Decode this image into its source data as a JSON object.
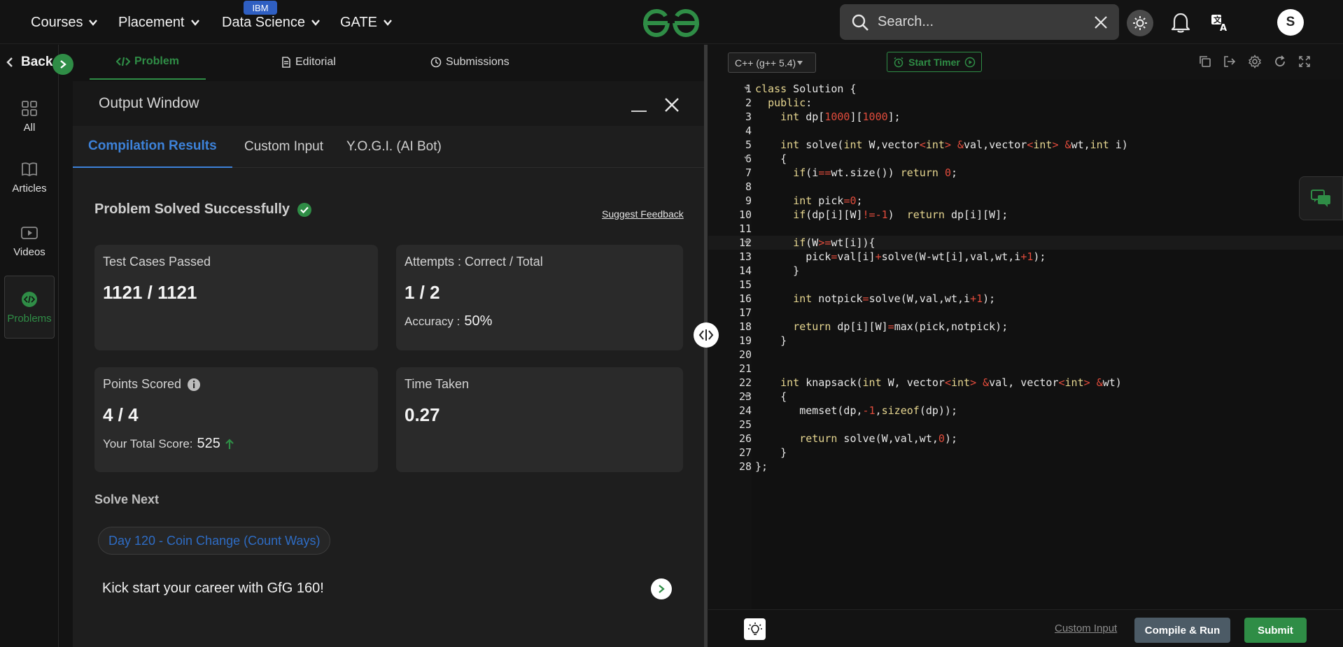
{
  "nav": {
    "items": [
      "Courses",
      "Placement",
      "Data Science",
      "GATE"
    ],
    "badge": "IBM",
    "search_placeholder": "Search...",
    "avatar_initial": "S"
  },
  "sidebar": {
    "back_label": "Back",
    "items": [
      {
        "label": "All",
        "icon": "grid-icon"
      },
      {
        "label": "Articles",
        "icon": "book-icon"
      },
      {
        "label": "Videos",
        "icon": "video-icon"
      },
      {
        "label": "Problems",
        "icon": "code-icon",
        "active": true
      }
    ]
  },
  "problem_tabs": [
    {
      "label": "Problem",
      "icon": "code-icon",
      "active": true
    },
    {
      "label": "Editorial",
      "icon": "document-icon"
    },
    {
      "label": "Submissions",
      "icon": "clock-icon"
    }
  ],
  "output": {
    "title": "Output Window",
    "tabs": [
      "Compilation Results",
      "Custom Input",
      "Y.O.G.I. (AI Bot)"
    ],
    "status": "Problem Solved Successfully",
    "suggest_feedback": "Suggest Feedback",
    "cards": {
      "tests": {
        "label": "Test Cases Passed",
        "value": "1121 / 1121"
      },
      "attempts": {
        "label": "Attempts : Correct / Total",
        "value": "1 / 2",
        "sub_label": "Accuracy :",
        "sub_value": "50%"
      },
      "points": {
        "label": "Points Scored",
        "value": "4 / 4",
        "sub_label": "Your Total Score:",
        "sub_value": "525"
      },
      "time": {
        "label": "Time Taken",
        "value": "0.27"
      }
    },
    "solve_next_label": "Solve Next",
    "next_problem": "Day 120 - Coin Change (Count Ways)",
    "kickstart": "Kick start your career with GfG 160!"
  },
  "editor": {
    "language": "C++ (g++ 5.4)",
    "timer_label": "Start Timer",
    "lines": [
      "class Solution {",
      "  public:",
      "    int dp[1000][1000];",
      "",
      "    int solve(int W,vector<int> &val,vector<int> &wt,int i)",
      "    {",
      "      if(i==wt.size()) return 0;",
      "",
      "      int pick=0;",
      "      if(dp[i][W]!=-1)  return dp[i][W];",
      "",
      "      if(W>=wt[i]){",
      "        pick=val[i]+solve(W-wt[i],val,wt,i+1);",
      "      }",
      "",
      "      int notpick=solve(W,val,wt,i+1);",
      "",
      "      return dp[i][W]=max(pick,notpick);",
      "    }",
      "",
      "",
      "    int knapsack(int W, vector<int> &val, vector<int> &wt)",
      "    {",
      "       memset(dp,-1,sizeof(dp));",
      "",
      "       return solve(W,val,wt,0);",
      "    }",
      "};"
    ]
  },
  "bottom": {
    "custom_input": "Custom Input",
    "compile": "Compile & Run",
    "submit": "Submit"
  }
}
